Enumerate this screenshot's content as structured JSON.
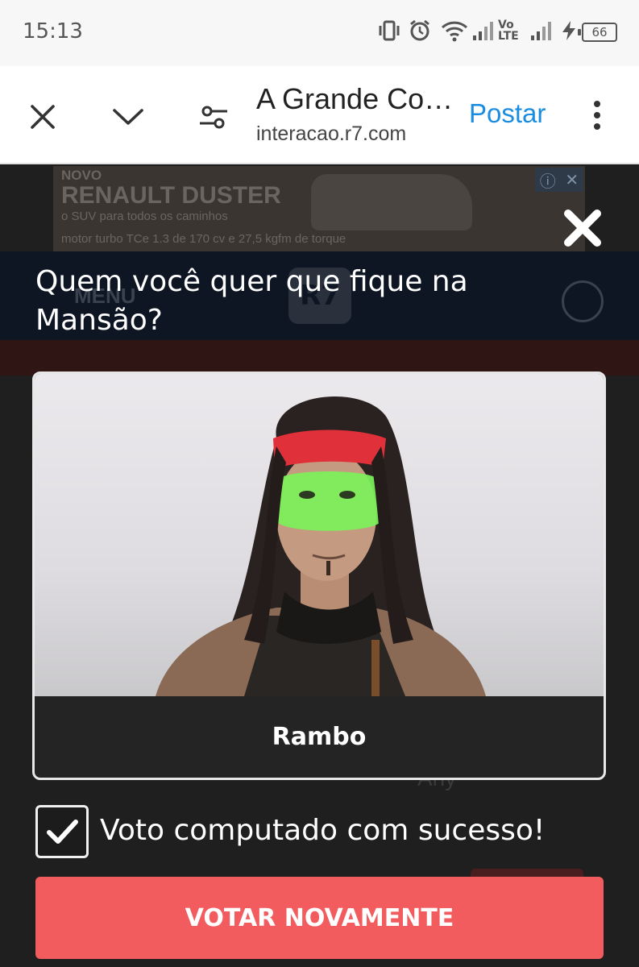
{
  "status_bar": {
    "time": "15:13",
    "signal_label": "Vo LTE",
    "battery": "66",
    "icons": [
      "vibrate-icon",
      "alarm-icon",
      "wifi-icon",
      "signal-icon",
      "signal-icon",
      "charging-icon",
      "battery-icon"
    ]
  },
  "browser": {
    "page_title": "A Grande Co…",
    "url": "interacao.r7.com",
    "post_label": "Postar",
    "icons": [
      "close-icon",
      "chevron-down-icon",
      "page-settings-icon",
      "more-vert-icon"
    ]
  },
  "background_page": {
    "ad": {
      "line1": "NOVO",
      "line2": "RENAULT DUSTER",
      "line3": "o SUV para todos os caminhos",
      "line4": "motor turbo TCe 1.3 de 170 cv e 27,5 kgfm de torque"
    },
    "menu_label": "MENU",
    "logo_text": "R7",
    "partial_name": "Arly"
  },
  "modal": {
    "question": "Quem você quer que fique na Mansão?",
    "candidate_name": "Rambo",
    "success_message": "Voto computado com sucesso!",
    "vote_again_label": "VOTAR NOVAMENTE"
  },
  "colors": {
    "accent_link": "#1a8de0",
    "vote_button": "#f25c5e",
    "overlay_bg": "#1c1c1c",
    "headband": "#e0303a",
    "face_paint": "#7cf25a"
  }
}
